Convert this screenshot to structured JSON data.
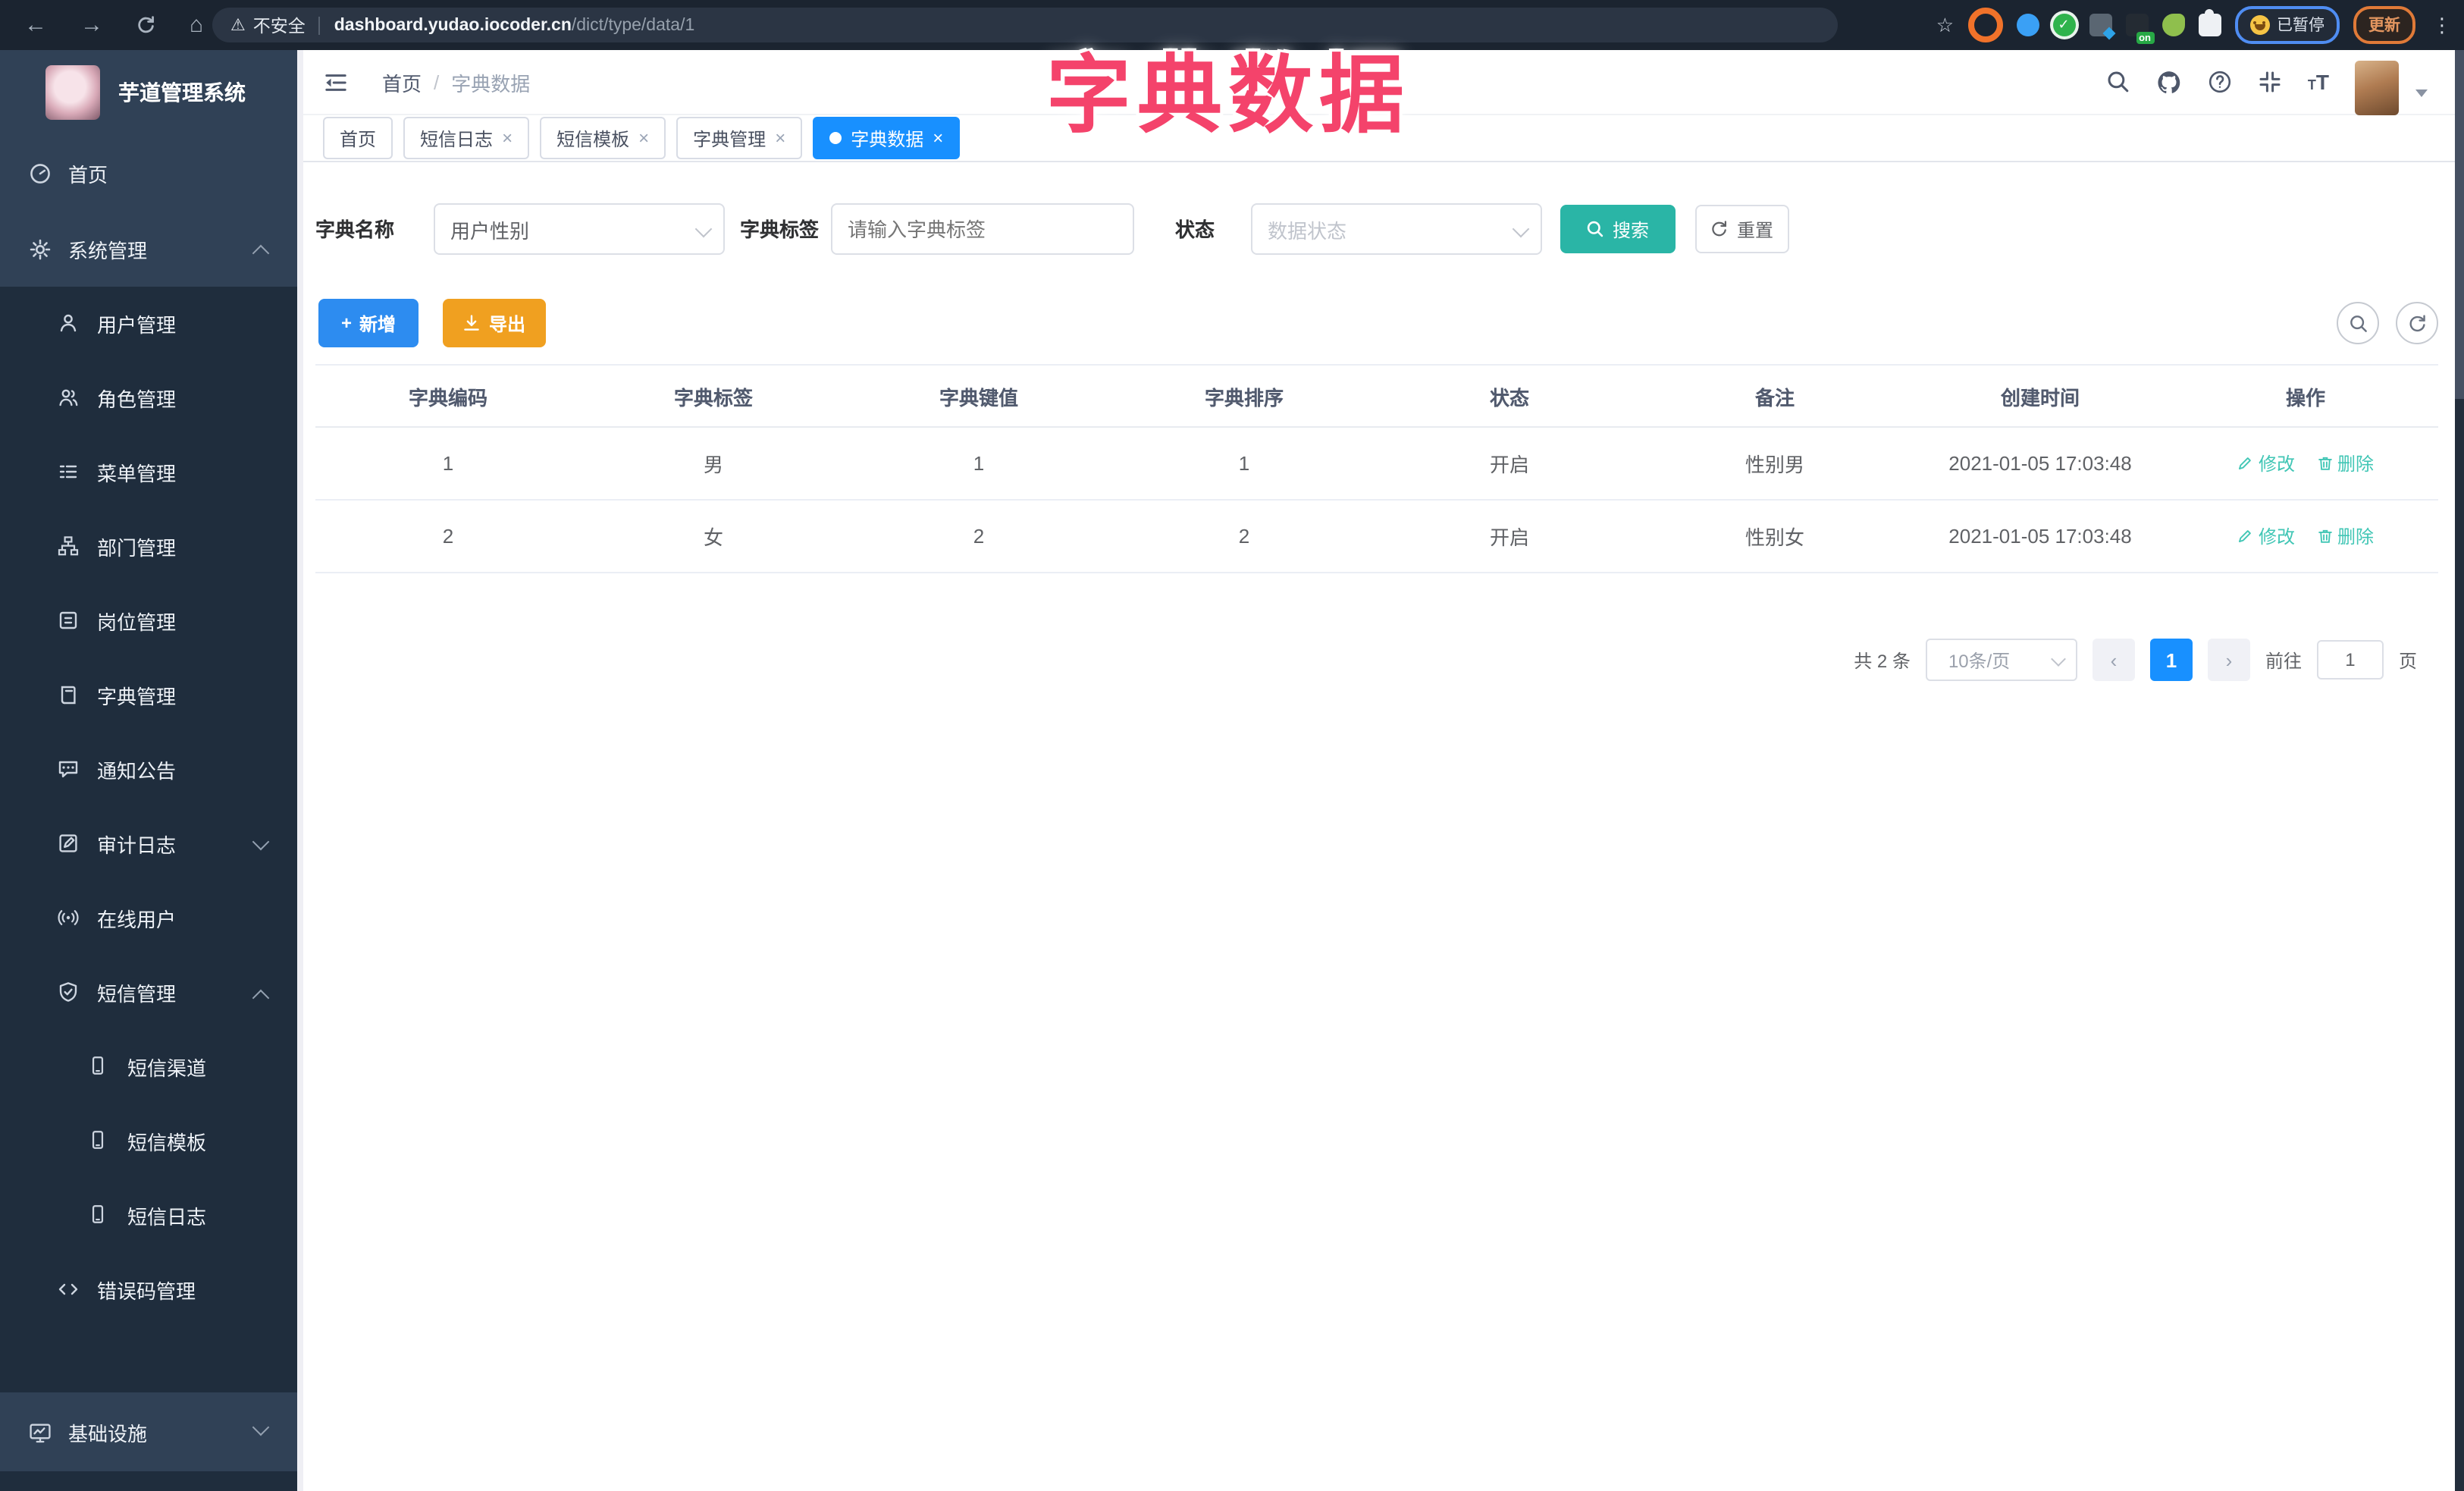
{
  "browser": {
    "security_label": "不安全",
    "url_host": "dashboard.yudao.iocoder.cn",
    "url_path": "/dict/type/data/1",
    "paused_badge": "已暂停",
    "update_button": "更新",
    "on_badge": "on"
  },
  "overlay": {
    "title": "字典数据"
  },
  "icons": {
    "back": "←",
    "forward": "→",
    "home": "⌂",
    "star": "☆",
    "warning": "⚠",
    "kebab": "⋮",
    "close": "×",
    "prev": "‹",
    "next": "›",
    "slash": "/",
    "plus": "+"
  },
  "sidebar": {
    "app_title": "芋道管理系统",
    "items": [
      {
        "label": "首页"
      },
      {
        "label": "系统管理"
      },
      {
        "label": "用户管理"
      },
      {
        "label": "角色管理"
      },
      {
        "label": "菜单管理"
      },
      {
        "label": "部门管理"
      },
      {
        "label": "岗位管理"
      },
      {
        "label": "字典管理"
      },
      {
        "label": "通知公告"
      },
      {
        "label": "审计日志"
      },
      {
        "label": "在线用户"
      },
      {
        "label": "短信管理"
      },
      {
        "label": "短信渠道"
      },
      {
        "label": "短信模板"
      },
      {
        "label": "短信日志"
      },
      {
        "label": "错误码管理"
      },
      {
        "label": "基础设施"
      }
    ]
  },
  "header": {
    "breadcrumb_home": "首页",
    "breadcrumb_current": "字典数据"
  },
  "tabs": [
    {
      "label": "首页"
    },
    {
      "label": "短信日志"
    },
    {
      "label": "短信模板"
    },
    {
      "label": "字典管理"
    },
    {
      "label": "字典数据"
    }
  ],
  "filters": {
    "dict_name_label": "字典名称",
    "dict_name_value": "用户性别",
    "dict_label_label": "字典标签",
    "dict_label_placeholder": "请输入字典标签",
    "status_label": "状态",
    "status_placeholder": "数据状态",
    "search_button": "搜索",
    "reset_button": "重置"
  },
  "toolbar": {
    "add_button": "新增",
    "export_button": "导出"
  },
  "table": {
    "columns": [
      "字典编码",
      "字典标签",
      "字典键值",
      "字典排序",
      "状态",
      "备注",
      "创建时间",
      "操作"
    ],
    "rows": [
      {
        "code": "1",
        "label": "男",
        "value": "1",
        "sort": "1",
        "status": "开启",
        "remark": "性别男",
        "created": "2021-01-05 17:03:48",
        "edit": "修改",
        "delete": "删除"
      },
      {
        "code": "2",
        "label": "女",
        "value": "2",
        "sort": "2",
        "status": "开启",
        "remark": "性别女",
        "created": "2021-01-05 17:03:48",
        "edit": "修改",
        "delete": "删除"
      }
    ]
  },
  "pagination": {
    "total": "共 2 条",
    "page_size": "10条/页",
    "current_page": "1",
    "goto_label": "前往",
    "goto_value": "1",
    "page_unit": "页"
  },
  "colors": {
    "accent_blue": "#1890ff",
    "primary_button_blue": "#2d8cf0",
    "search_teal": "#2ab5a6",
    "export_orange": "#f0a020",
    "action_link_teal": "#41c6b5",
    "overlay_pink": "#f4436b",
    "sidebar_bg": "#304156",
    "submenu_bg": "#1f2d3d"
  }
}
